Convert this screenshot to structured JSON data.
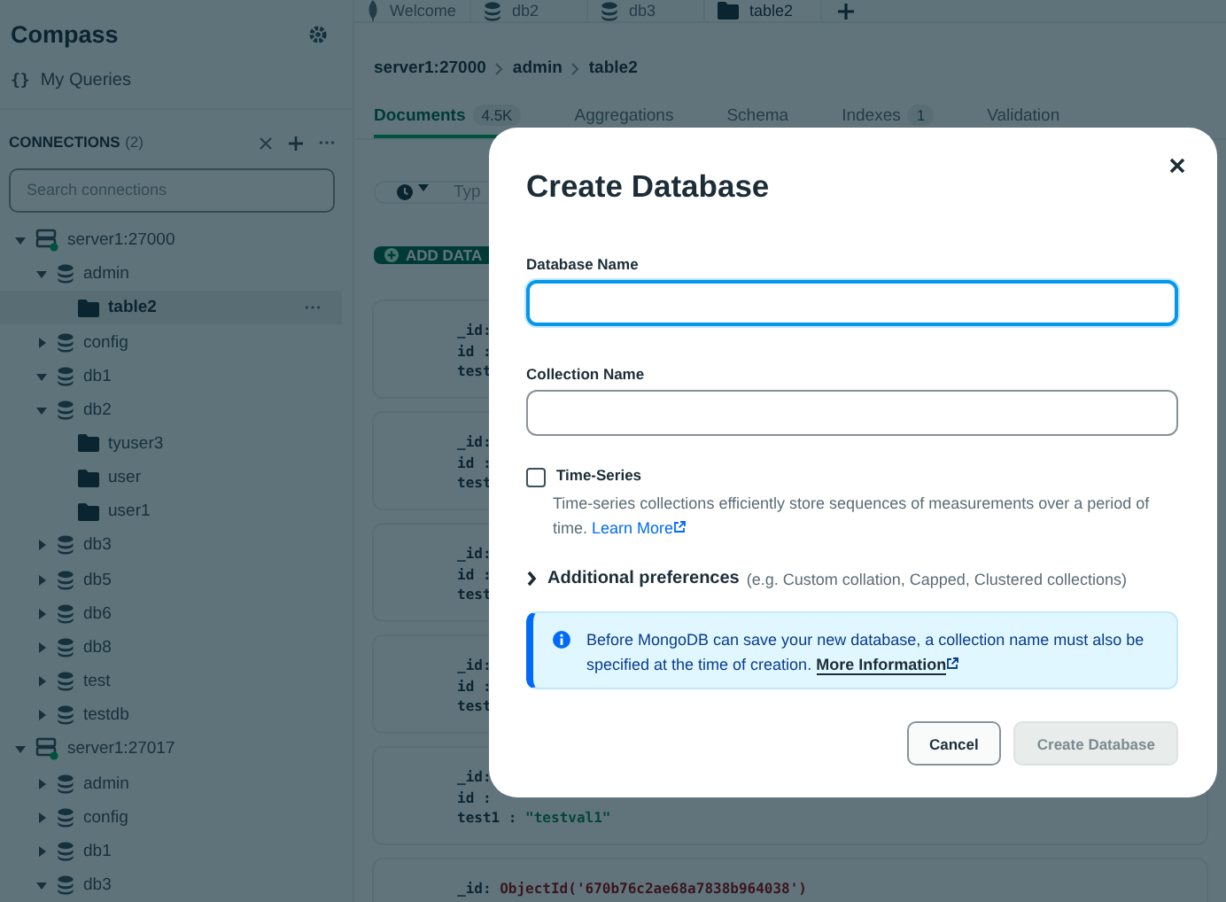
{
  "sidebar": {
    "title": "Compass",
    "my_queries_icon": "{}",
    "my_queries": "My Queries",
    "connections_label": "CONNECTIONS",
    "connections_count": "(2)",
    "search": {
      "placeholder": "Search connections"
    },
    "tree": [
      {
        "label": "server1:27000",
        "kind": "server",
        "expanded": true,
        "selected": false,
        "children": [
          {
            "label": "admin",
            "kind": "database",
            "expanded": true,
            "selected": false,
            "children": [
              {
                "label": "table2",
                "kind": "collection",
                "selected": true
              }
            ]
          },
          {
            "label": "config",
            "kind": "database",
            "expanded": false,
            "selected": false
          },
          {
            "label": "db1",
            "kind": "database",
            "expanded": true,
            "selected": false
          },
          {
            "label": "db2",
            "kind": "database",
            "expanded": true,
            "selected": false,
            "children": [
              {
                "label": "tyuser3",
                "kind": "collection",
                "selected": false
              },
              {
                "label": "user",
                "kind": "collection",
                "selected": false
              },
              {
                "label": "user1",
                "kind": "collection",
                "selected": false
              }
            ]
          },
          {
            "label": "db3",
            "kind": "database",
            "expanded": false,
            "selected": false
          },
          {
            "label": "db5",
            "kind": "database",
            "expanded": false,
            "selected": false
          },
          {
            "label": "db6",
            "kind": "database",
            "expanded": false,
            "selected": false
          },
          {
            "label": "db8",
            "kind": "database",
            "expanded": false,
            "selected": false
          },
          {
            "label": "test",
            "kind": "database",
            "expanded": false,
            "selected": false
          },
          {
            "label": "testdb",
            "kind": "database",
            "expanded": false,
            "selected": false
          }
        ]
      },
      {
        "label": "server1:27017",
        "kind": "server",
        "expanded": true,
        "selected": false,
        "children": [
          {
            "label": "admin",
            "kind": "database",
            "expanded": false,
            "selected": false
          },
          {
            "label": "config",
            "kind": "database",
            "expanded": false,
            "selected": false
          },
          {
            "label": "db1",
            "kind": "database",
            "expanded": false,
            "selected": false
          },
          {
            "label": "db3",
            "kind": "database",
            "expanded": true,
            "selected": false
          }
        ]
      }
    ]
  },
  "workspace": {
    "tabs": [
      {
        "label": "Welcome",
        "kind": "welcome",
        "selected": false
      },
      {
        "label": "db2",
        "kind": "database",
        "selected": false
      },
      {
        "label": "db3",
        "kind": "database",
        "selected": false
      },
      {
        "label": "table2",
        "kind": "collection",
        "selected": true
      }
    ],
    "breadcrumb": [
      "server1:27000",
      "admin",
      "table2"
    ],
    "subtabs": [
      {
        "label": "Documents",
        "count": "4.5K",
        "selected": true
      },
      {
        "label": "Aggregations",
        "selected": false
      },
      {
        "label": "Schema",
        "selected": false
      },
      {
        "label": "Indexes",
        "count": "1",
        "selected": false
      },
      {
        "label": "Validation",
        "selected": false
      }
    ],
    "query_placeholder": "Typ",
    "add_data": "ADD DATA",
    "documents": [
      {
        "lines": [
          {
            "key": "_id:"
          },
          {
            "key": "id :"
          },
          {
            "key": "test"
          }
        ]
      },
      {
        "lines": [
          {
            "key": "_id:"
          },
          {
            "key": "id :"
          },
          {
            "key": "test"
          }
        ]
      },
      {
        "lines": [
          {
            "key": "_id:"
          },
          {
            "key": "id :"
          },
          {
            "key": "test"
          }
        ]
      },
      {
        "lines": [
          {
            "key": "_id:"
          },
          {
            "key": "id :"
          },
          {
            "key": "test"
          }
        ]
      },
      {
        "lines": [
          {
            "key": "_id:"
          },
          {
            "key": "id :"
          },
          {
            "key": "test1 :",
            "value": "\"testval1\"",
            "kind": "string"
          }
        ]
      },
      {
        "lines": [
          {
            "key": "_id:",
            "value": "ObjectId('670b76c2ae68a7838b964038')",
            "kind": "objectid"
          }
        ]
      }
    ]
  },
  "modal": {
    "title": "Create Database",
    "fields": [
      {
        "label": "Database Name",
        "focused": true
      },
      {
        "label": "Collection Name",
        "focused": false
      }
    ],
    "time_series": {
      "label": "Time-Series",
      "checked": false,
      "description": "Time-series collections efficiently store sequences of measurements over a period of time.",
      "link": "Learn More"
    },
    "additional": {
      "label": "Additional preferences",
      "hint": "(e.g. Custom collation, Capped, Clustered collections)",
      "expanded": false
    },
    "callout": {
      "text": "Before MongoDB can save your new database, a collection name must also be specified at the time of creation.",
      "link": "More Information"
    },
    "buttons": [
      {
        "label": "Cancel",
        "kind": "secondary",
        "disabled": false
      },
      {
        "label": "Create Database",
        "kind": "primary",
        "disabled": true
      }
    ]
  }
}
